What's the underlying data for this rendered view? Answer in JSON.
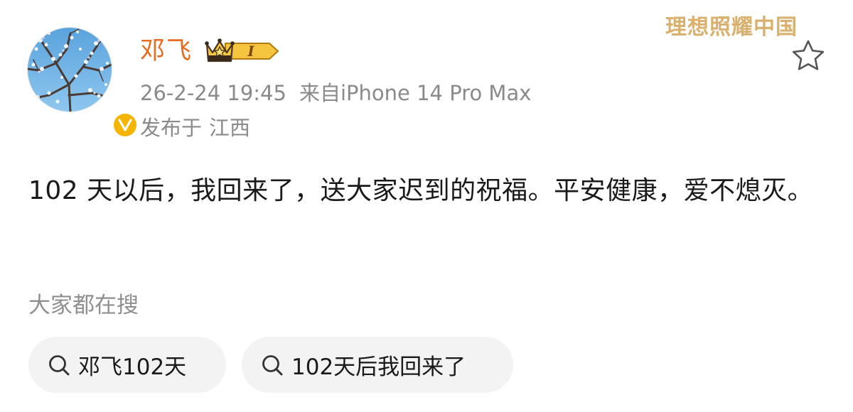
{
  "header": {
    "username": "邓飞",
    "vip_level": "I",
    "timestamp": "26-2-24 19:45",
    "source": "来自iPhone 14 Pro Max",
    "location_prefix": "发布于",
    "location": "江西",
    "watermark": "理想照耀中国"
  },
  "post": {
    "text": "102 天以后，我回来了，送大家迟到的祝福。平安健康，爱不熄灭。"
  },
  "trending": {
    "title": "大家都在搜",
    "chips": [
      {
        "label": "邓飞102天",
        "icon": "search-icon"
      },
      {
        "label": "102天后我回来了",
        "icon": "search-icon"
      }
    ]
  },
  "icons": {
    "favorite": "star-outline-icon",
    "verified": "verified-v-icon",
    "vip": "crown-icon"
  },
  "colors": {
    "username": "#ea6a1f",
    "meta_text": "#8a8a8a",
    "verified_badge": "#f4b400",
    "watermark": "#d9b06e",
    "chip_background": "#f3f3f3"
  }
}
